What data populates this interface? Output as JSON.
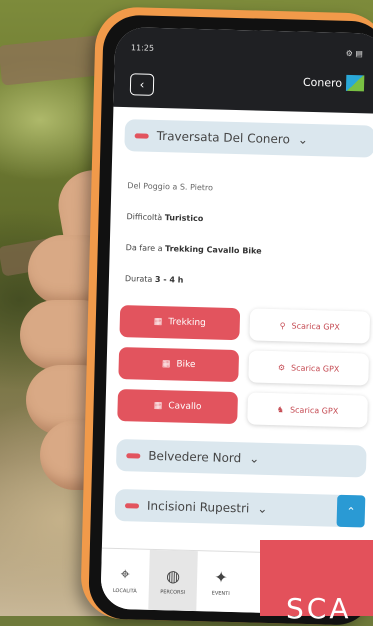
{
  "status_bar": {
    "time": "11:25",
    "icons": "⊙ ⊕ ●",
    "right": "⚙ ▤"
  },
  "header": {
    "logo_text": "Conero"
  },
  "route": {
    "title": "Traversata Del Conero"
  },
  "details": {
    "subtitle": "Del Poggio a S. Pietro",
    "difficulty_label": "Difficoltà",
    "difficulty_value": "Turistico",
    "mode_label": "Da fare a",
    "mode_value": "Trekking Cavallo Bike",
    "duration_label": "Durata",
    "duration_value": "3 - 4 h"
  },
  "modes": [
    {
      "label": "Trekking",
      "download": "Scarica GPX"
    },
    {
      "label": "Bike",
      "download": "Scarica GPX"
    },
    {
      "label": "Cavallo",
      "download": "Scarica GPX"
    }
  ],
  "sections": [
    {
      "title": "Belvedere Nord"
    },
    {
      "title": "Incisioni Rupestri"
    }
  ],
  "nav": [
    "LOCALITÀ",
    "PERCORSI",
    "EVENTI"
  ],
  "overlay_text": "SCA",
  "colors": {
    "accent": "#e2545e",
    "phone_case": "#f19a4a",
    "pill": "#dbe7ee"
  }
}
